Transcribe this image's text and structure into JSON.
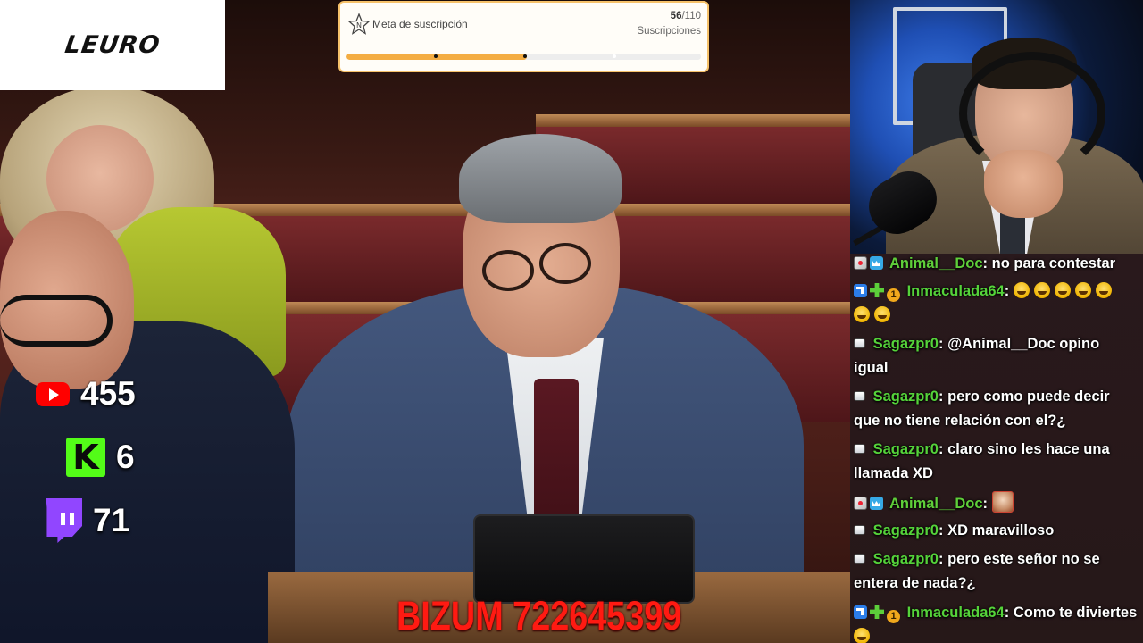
{
  "logo": {
    "text": "LEURO"
  },
  "goal": {
    "title": "Meta de suscripción",
    "current": "56",
    "total": "/110",
    "label": "Suscripciones",
    "progress": 0.509
  },
  "platforms": [
    {
      "name": "youtube",
      "icon": "youtube-icon",
      "count": "455",
      "color": "#ff0000"
    },
    {
      "name": "kick",
      "icon": "kick-icon",
      "glyph": "K",
      "count": "6",
      "color": "#53fc18"
    },
    {
      "name": "twitch",
      "icon": "twitch-icon",
      "count": "71",
      "color": "#9146ff"
    }
  ],
  "banner": {
    "text": "BIZUM 722645399",
    "color": "#ff1a12"
  },
  "chat": {
    "messages": [
      {
        "user": "Animal__Doc",
        "sep": ": ",
        "text": "no para contestar",
        "badges": [
          "sub-badge",
          "crown-badge"
        ]
      },
      {
        "user": "Inmaculada64",
        "sep": ": ",
        "text": "",
        "badges": [
          "arrow-badge",
          "plus-badge",
          "one-badge"
        ],
        "emotes": 7
      },
      {
        "user": "Sagazpr0",
        "sep": ": ",
        "text": "@Animal__Doc opino igual",
        "badges": [
          "mod-badge"
        ]
      },
      {
        "user": "Sagazpr0",
        "sep": ": ",
        "text": "pero como puede decir que no tiene relación con el?¿",
        "badges": [
          "mod-badge"
        ]
      },
      {
        "user": "Sagazpr0",
        "sep": ": ",
        "text": "claro sino les hace una llamada XD",
        "badges": [
          "mod-badge"
        ]
      },
      {
        "user": "Animal__Doc",
        "sep": ": ",
        "text": "",
        "badges": [
          "sub-badge",
          "crown-badge"
        ],
        "image_emote": true
      },
      {
        "user": "Sagazpr0",
        "sep": ": ",
        "text": "XD maravilloso",
        "badges": [
          "mod-badge"
        ]
      },
      {
        "user": "Sagazpr0",
        "sep": ": ",
        "text": "pero este señor no se entera de nada?¿",
        "badges": [
          "mod-badge"
        ]
      },
      {
        "user": "Inmaculada64",
        "sep": ": ",
        "text": "Como te diviertes",
        "badges": [
          "arrow-badge",
          "plus-badge",
          "one-badge"
        ],
        "emotes": 1
      }
    ],
    "one_badge_label": "1"
  },
  "colors": {
    "username": "#55d33a",
    "goal_border": "#f6c26b",
    "goal_fill": "#f4ad43"
  }
}
